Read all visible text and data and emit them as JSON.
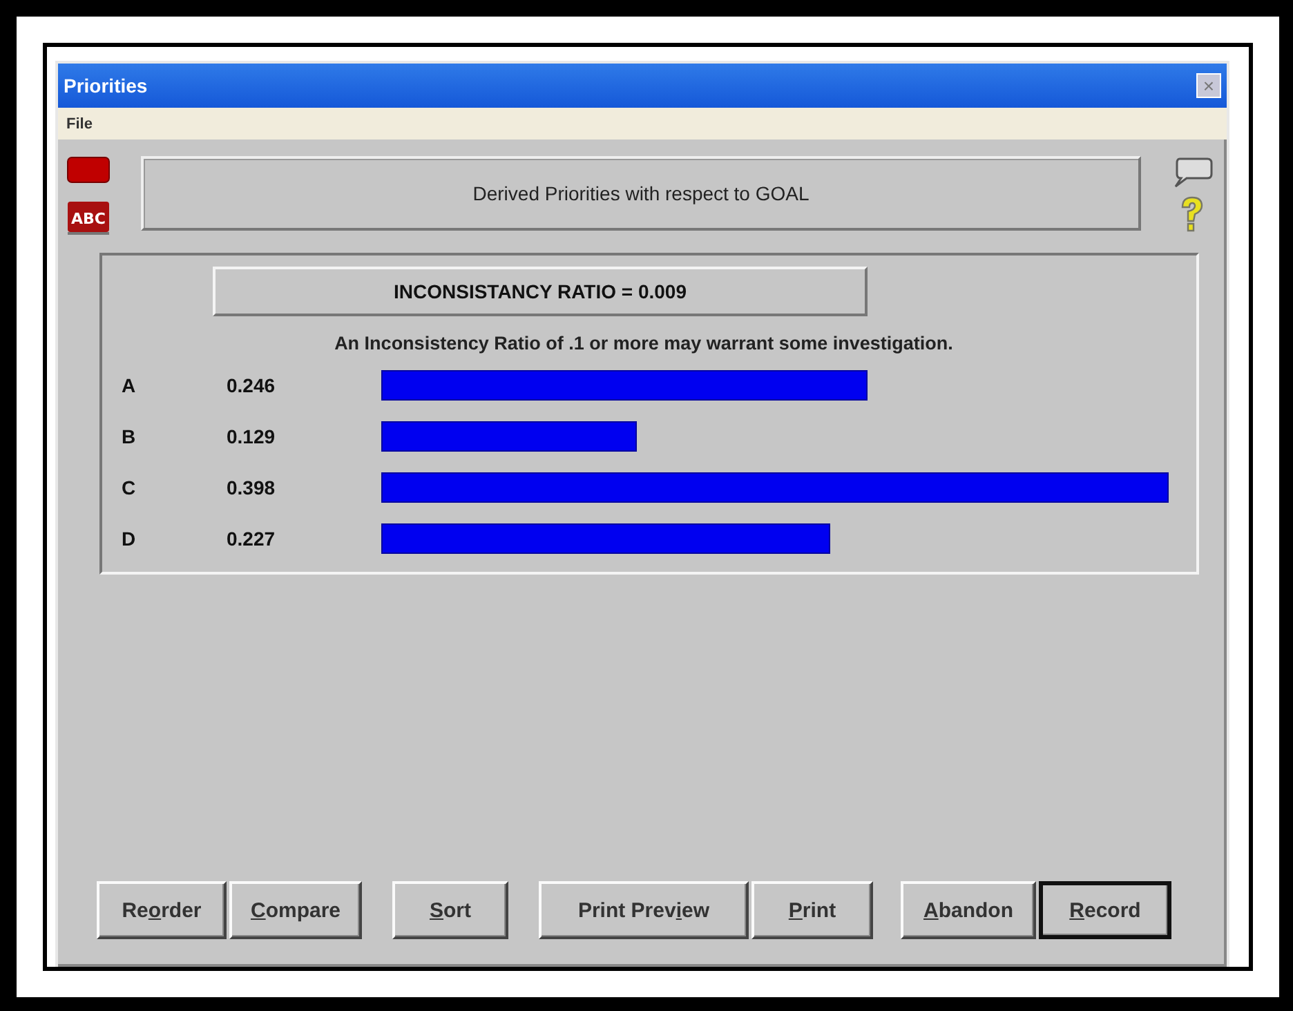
{
  "window": {
    "title": "Priorities",
    "close": "×"
  },
  "menu": [
    "File"
  ],
  "icon_label": "ABC",
  "header": "Derived Priorities with respect to GOAL",
  "ratio": "INCONSISTANCY RATIO = 0.009",
  "note": "An Inconsistency Ratio of .1 or more may warrant some investigation.",
  "priorities": [
    {
      "name": "A",
      "value": "0.246"
    },
    {
      "name": "B",
      "value": "0.129"
    },
    {
      "name": "C",
      "value": "0.398"
    },
    {
      "name": "D",
      "value": "0.227"
    }
  ],
  "button_groups": [
    [
      {
        "label": "Reorder",
        "default": false
      },
      {
        "label": "Compare",
        "default": false
      }
    ],
    [
      {
        "label": "Sort",
        "default": false
      }
    ],
    [
      {
        "label": "Print Preview",
        "default": false
      },
      {
        "label": "Print",
        "default": false
      }
    ],
    [
      {
        "label": "Abandon",
        "default": false
      },
      {
        "label": "Record",
        "default": true
      }
    ]
  ]
}
